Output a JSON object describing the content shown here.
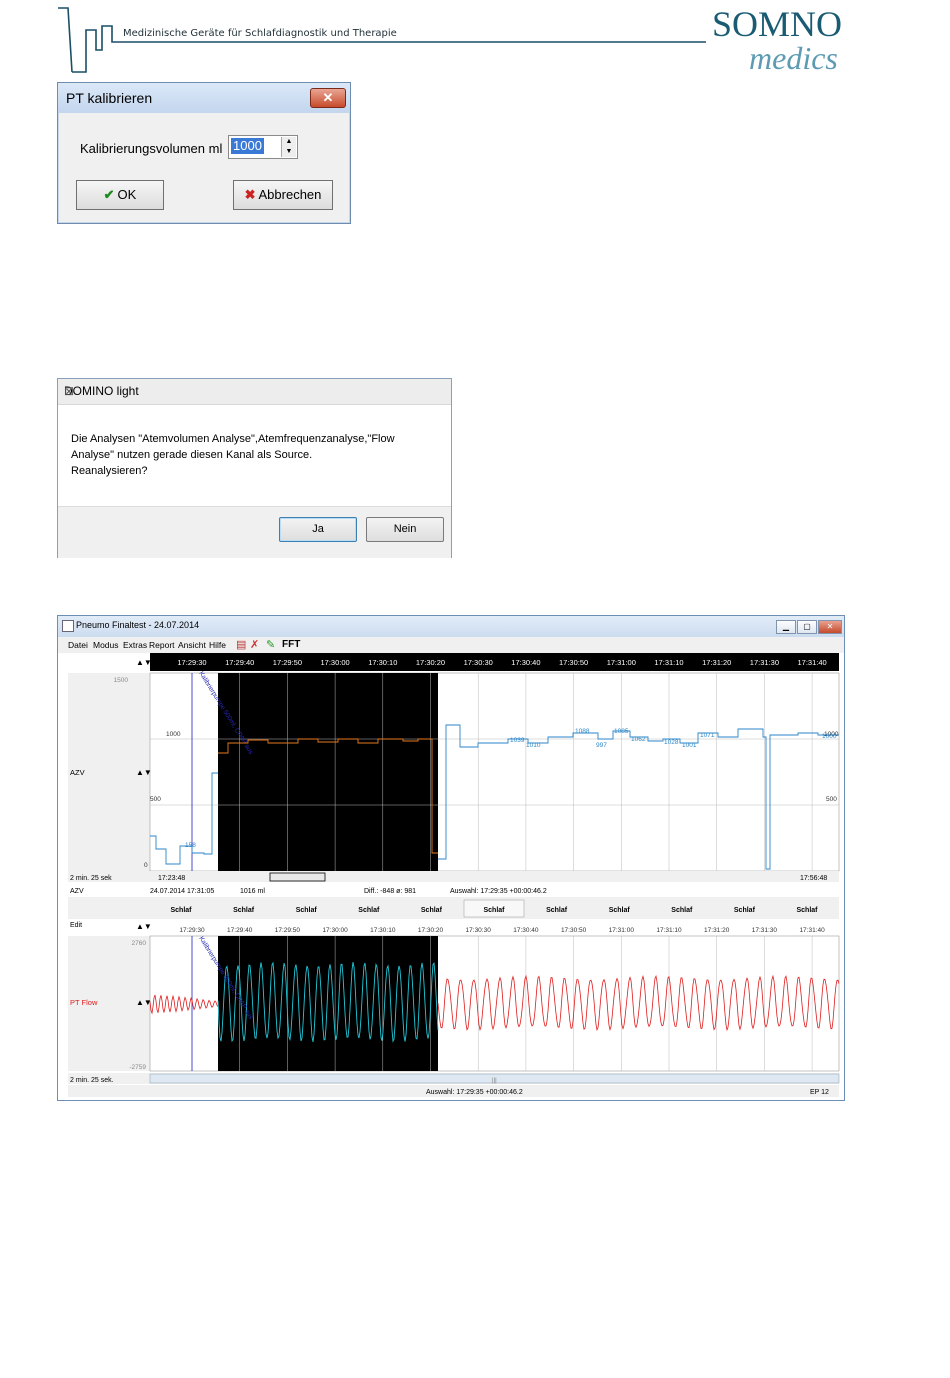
{
  "header": {
    "tagline": "Medizinische Geräte für Schlafdiagnostik und Therapie",
    "logo_line1": "SOMNO",
    "logo_line2": "medics"
  },
  "dialog_calibrate": {
    "title": "PT kalibrieren",
    "close_glyph": "✕",
    "volume_label": "Kalibrierungsvolumen ml",
    "volume_value": "1000",
    "ok_label": "OK",
    "cancel_label": "Abbrechen"
  },
  "dialog_reanalyze": {
    "title": "DOMINO light",
    "close_glyph": "⊠",
    "message_line1": "Die Analysen \"Atemvolumen Analyse\",Atemfrequenzanalyse,\"Flow",
    "message_line2": "Analyse\" nutzen gerade diesen Kanal als Source.",
    "message_line3": "Reanalysieren?",
    "yes_label": "Ja",
    "no_label": "Nein"
  },
  "app": {
    "title": "Pneumo Finaltest  - 24.07.2014",
    "menu": [
      "Datei",
      "Modus",
      "Extras",
      "Report",
      "Ansicht",
      "Hilfe"
    ],
    "toolbar_fft": "FFT",
    "time_ticks": [
      "17:29:30",
      "17:29:40",
      "17:29:50",
      "17:30:00",
      "17:30:10",
      "17:30:20",
      "17:30:30",
      "17:30:40",
      "17:30:50",
      "17:31:00",
      "17:31:10",
      "17:31:20",
      "17:31:30",
      "17:31:40"
    ],
    "azv_channel": {
      "label": "AZV",
      "y_top": "1500",
      "y_1000": "1000",
      "y_500": "500",
      "y_0": "0",
      "right_1000": "1000",
      "right_500": "500",
      "annotation": "Kalibrierpumpe 500ml, CPAP aus",
      "value_labels": [
        "158",
        "1039",
        "1010",
        "1088",
        "997",
        "1085",
        "1062",
        "1028",
        "1001",
        "1071",
        "1000"
      ]
    },
    "scroll_info": {
      "span": "2 min.  25 sek",
      "start_time": "17:23:48",
      "end_time": "17:56:48"
    },
    "status_row": {
      "channel": "AZV",
      "datetime": "24.07.2014  17:31:05",
      "value": "1016 ml",
      "diff": "Diff.: -848  ø: 981",
      "selection": "Auswahl: 17:29:35  +00:00:46.2"
    },
    "edit_label": "Edit",
    "stage_labels": [
      "Schlaf",
      "Schlaf",
      "Schlaf",
      "Schlaf",
      "Schlaf",
      "Schlaf",
      "Schlaf",
      "Schlaf",
      "Schlaf",
      "Schlaf",
      "Schlaf"
    ],
    "flow_channel": {
      "label": "PT Flow",
      "y_top": "2760",
      "y_bottom": "-2759",
      "annotation": "Kalibrierpumpe 500ml, CPAP aus"
    },
    "bottom": {
      "span": "2 min.  25 sek.",
      "selection": "Auswahl: 17:29:35  +00:00:46.2",
      "ep": "EP 12",
      "scroll_mid": "|||"
    }
  }
}
